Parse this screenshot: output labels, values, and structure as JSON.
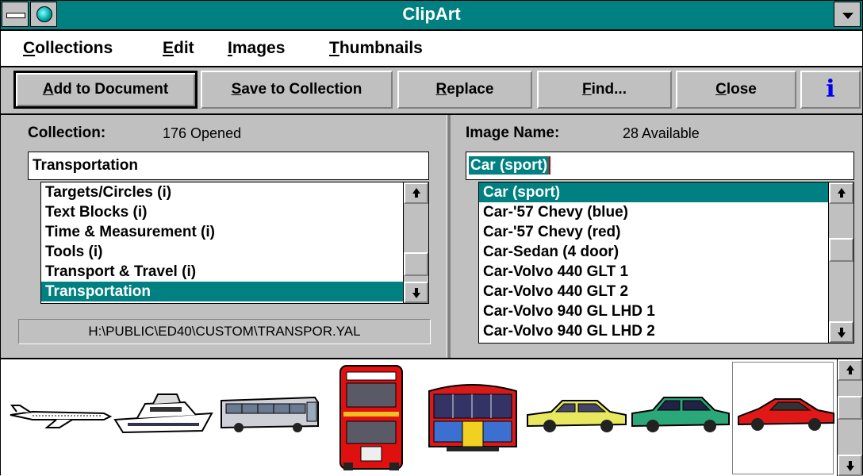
{
  "window": {
    "title": "ClipArt"
  },
  "menu": {
    "collections": {
      "key": "C",
      "rest": "ollections"
    },
    "edit": {
      "key": "E",
      "rest": "dit"
    },
    "images": {
      "key": "I",
      "rest": "mages"
    },
    "thumbnails": {
      "key": "T",
      "rest": "humbnails"
    }
  },
  "toolbar": {
    "add": {
      "key": "A",
      "rest": "dd to Document"
    },
    "save": {
      "key": "S",
      "rest": "ave to Collection"
    },
    "replace": {
      "key": "R",
      "rest": "eplace"
    },
    "find": {
      "key": "F",
      "rest": "ind..."
    },
    "close": {
      "key": "C",
      "rest": "lose"
    },
    "info": "i"
  },
  "collection": {
    "label": "Collection:",
    "count": "176 Opened",
    "value": "Transportation",
    "items": [
      {
        "label": "Targets/Circles (i)",
        "selected": false
      },
      {
        "label": "Text Blocks (i)",
        "selected": false
      },
      {
        "label": "Time & Measurement (i)",
        "selected": false
      },
      {
        "label": "Tools (i)",
        "selected": false
      },
      {
        "label": "Transport & Travel (i)",
        "selected": false
      },
      {
        "label": "Transportation",
        "selected": true
      }
    ],
    "path": "H:\\PUBLIC\\ED40\\CUSTOM\\TRANSPOR.YAL"
  },
  "image_name": {
    "label": "Image Name:",
    "count": "28 Available",
    "value": "Car (sport)",
    "items": [
      {
        "label": "Car (sport)",
        "selected": true
      },
      {
        "label": "Car-'57 Chevy (blue)",
        "selected": false
      },
      {
        "label": "Car-'57 Chevy (red)",
        "selected": false
      },
      {
        "label": "Car-Sedan (4 door)",
        "selected": false
      },
      {
        "label": "Car-Volvo 440 GLT 1",
        "selected": false
      },
      {
        "label": "Car-Volvo 440 GLT 2",
        "selected": false
      },
      {
        "label": "Car-Volvo 940 GL LHD 1",
        "selected": false
      },
      {
        "label": "Car-Volvo 940 GL LHD 2",
        "selected": false
      }
    ]
  },
  "thumbnails": [
    "jet",
    "yacht",
    "coach bus",
    "double-decker bus",
    "trolley",
    "sedan yellow",
    "sedan green",
    "sport car red"
  ],
  "colors": {
    "titlebar": "#008080",
    "selection": "#008080",
    "face": "#c0c0c0",
    "info": "#0000ee"
  }
}
